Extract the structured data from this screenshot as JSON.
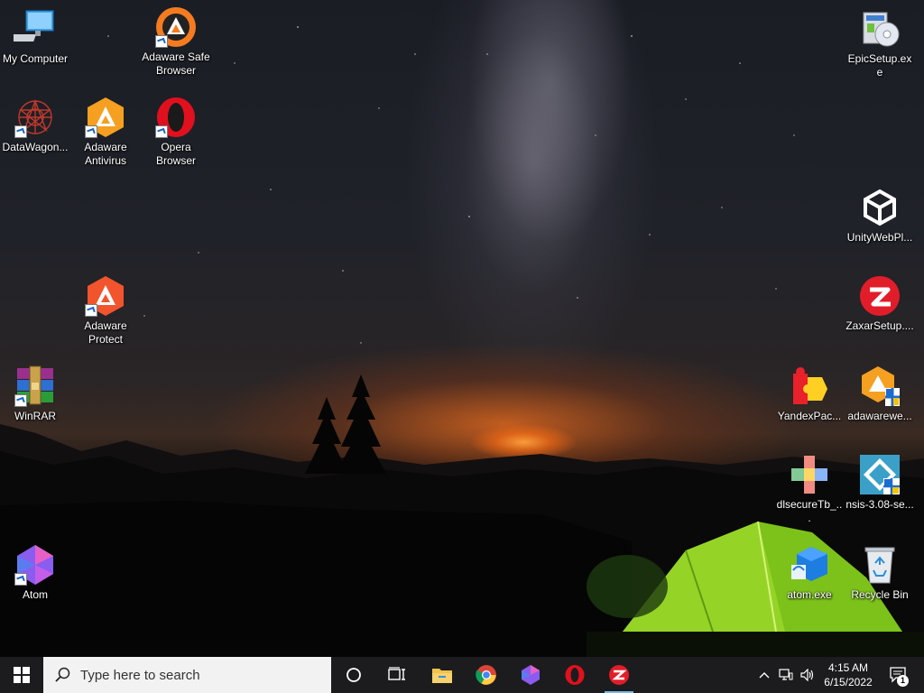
{
  "desktop": {
    "icons": [
      {
        "label": "My Computer",
        "icon": "computer-icon"
      },
      {
        "label": "Adaware Safe Browser",
        "icon": "adaware-browser-icon"
      },
      {
        "label": "EpicSetup.exe",
        "icon": "installer-disc-icon"
      },
      {
        "label": "DataWagon...",
        "icon": "datawagon-icon"
      },
      {
        "label": "Adaware Antivirus",
        "icon": "adaware-antivirus-icon"
      },
      {
        "label": "Opera Browser",
        "icon": "opera-icon"
      },
      {
        "label": "UnityWebPl...",
        "icon": "unity-icon"
      },
      {
        "label": "Adaware Protect",
        "icon": "adaware-protect-icon"
      },
      {
        "label": "ZaxarSetup....",
        "icon": "zaxar-icon"
      },
      {
        "label": "WinRAR",
        "icon": "winrar-icon"
      },
      {
        "label": "YandexPac...",
        "icon": "yandex-puzzle-icon"
      },
      {
        "label": "adawarewe...",
        "icon": "adaware-web-installer-icon"
      },
      {
        "label": "dlsecureTb_...",
        "icon": "dlsecure-icon"
      },
      {
        "label": "nsis-3.08-se...",
        "icon": "nsis-icon"
      },
      {
        "label": "Atom",
        "icon": "atom-icon"
      },
      {
        "label": "atom.exe",
        "icon": "atom-installer-icon"
      },
      {
        "label": "Recycle Bin",
        "icon": "recycle-bin-icon"
      }
    ]
  },
  "taskbar": {
    "search_placeholder": "Type here to search",
    "apps": [
      "cortana-icon",
      "task-view-icon",
      "file-explorer-icon",
      "chrome-icon",
      "atom-icon",
      "opera-icon",
      "zaxar-icon"
    ],
    "clock": {
      "time": "4:15 AM",
      "date": "6/15/2022"
    },
    "notification_count": "1"
  },
  "colors": {
    "taskbar": "#1c1c1e",
    "adaware_orange": "#f47b20",
    "opera_red": "#e0101e",
    "search_bg": "#f2f2f2"
  }
}
